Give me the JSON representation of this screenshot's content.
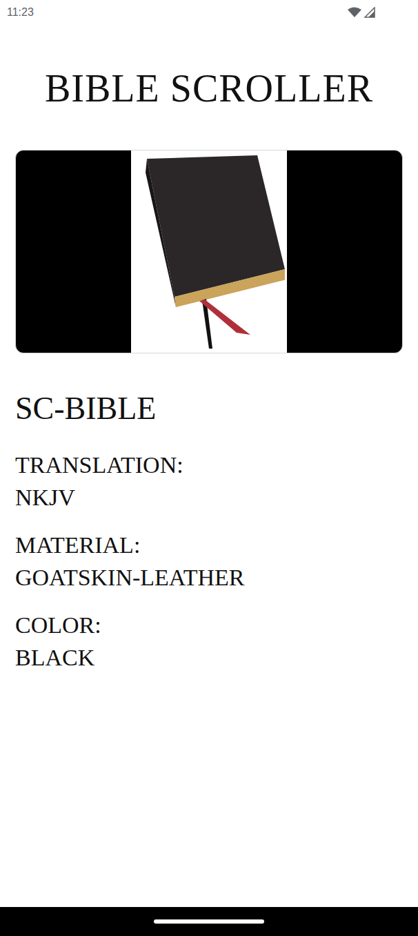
{
  "status_bar": {
    "time": "11:23"
  },
  "title": "BIBLE SCROLLER",
  "product": {
    "name": "SC-BIBLE",
    "specs": [
      {
        "label": "TRANSLATION:",
        "value": "NKJV"
      },
      {
        "label": "MATERIAL:",
        "value": "GOATSKIN-LEATHER"
      },
      {
        "label": "COLOR:",
        "value": "BLACK"
      }
    ]
  }
}
